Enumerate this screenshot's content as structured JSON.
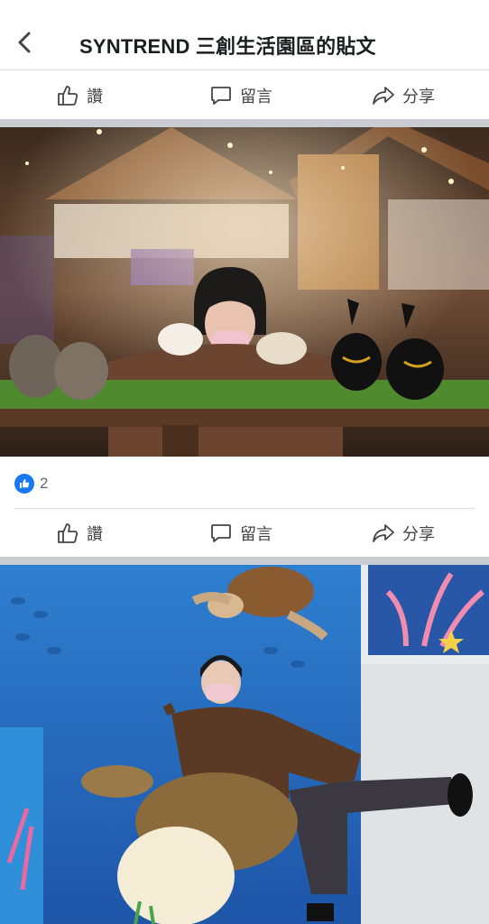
{
  "header": {
    "title": "SYNTREND 三創生活園區的貼文"
  },
  "actions": {
    "like_label": "讚",
    "comment_label": "留言",
    "share_label": "分享"
  },
  "post1": {
    "like_count": "2",
    "reaction_icon": "thumbs-up-icon"
  },
  "colors": {
    "accent": "#1877f2",
    "divider": "#c9ccd1"
  },
  "photos": [
    {
      "name": "photo-plush-animals",
      "subject": "person with plush animals on grass table"
    },
    {
      "name": "photo-sea-turtle",
      "subject": "person posing with sea turtle plush on ocean backdrop"
    }
  ]
}
